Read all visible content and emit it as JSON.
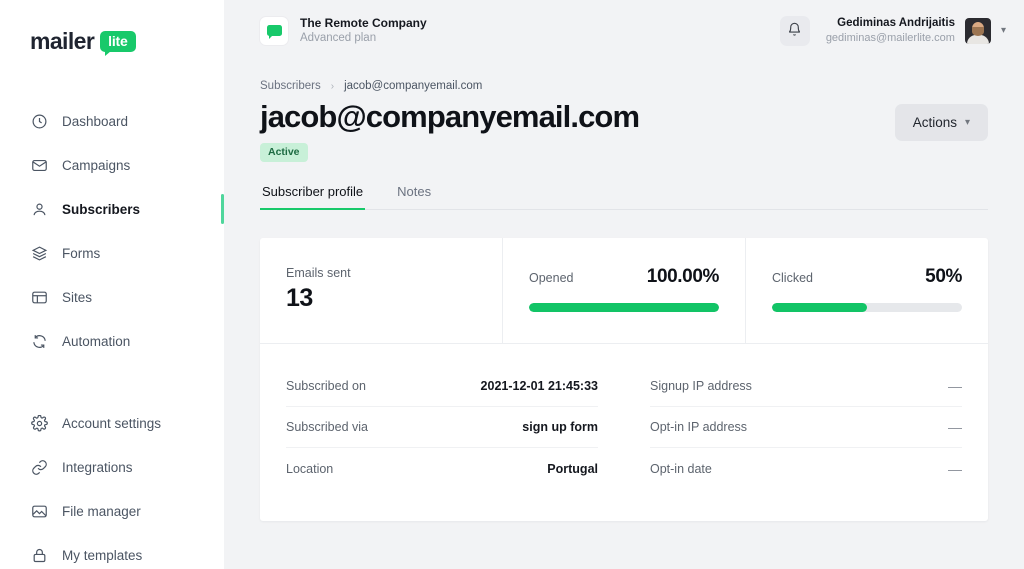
{
  "sidebar": {
    "logo": {
      "part1": "mailer",
      "part2": "lite"
    },
    "items": [
      {
        "label": "Dashboard",
        "icon": "clock-icon",
        "active": false
      },
      {
        "label": "Campaigns",
        "icon": "envelope-icon",
        "active": false
      },
      {
        "label": "Subscribers",
        "icon": "user-icon",
        "active": true
      },
      {
        "label": "Forms",
        "icon": "layers-icon",
        "active": false
      },
      {
        "label": "Sites",
        "icon": "browser-icon",
        "active": false
      },
      {
        "label": "Automation",
        "icon": "refresh-icon",
        "active": false
      },
      {
        "label": "Account settings",
        "icon": "gear-icon",
        "active": false
      },
      {
        "label": "Integrations",
        "icon": "link-icon",
        "active": false
      },
      {
        "label": "File manager",
        "icon": "image-icon",
        "active": false
      },
      {
        "label": "My templates",
        "icon": "lock-icon",
        "active": false
      }
    ]
  },
  "topbar": {
    "org_name": "The Remote Company",
    "org_plan": "Advanced plan",
    "org_logo_icon": "chat-bubble-icon",
    "bell_icon": "bell-icon",
    "user_name": "Gediminas Andrijaitis",
    "user_email": "gediminas@mailerlite.com",
    "avatar_icon": "avatar",
    "caret_icon": "chevron-down-icon"
  },
  "breadcrumb": {
    "root": "Subscribers",
    "separator": "›",
    "current": "jacob@companyemail.com"
  },
  "header": {
    "title": "jacob@companyemail.com",
    "status": "Active",
    "actions_label": "Actions",
    "actions_caret": "chevron-down-icon"
  },
  "tabs": [
    {
      "label": "Subscriber profile",
      "active": true
    },
    {
      "label": "Notes",
      "active": false
    }
  ],
  "stats": {
    "emails_sent": {
      "label": "Emails sent",
      "value": "13"
    },
    "opened": {
      "label": "Opened",
      "value": "100.00%",
      "percent": 100
    },
    "clicked": {
      "label": "Clicked",
      "value": "50%",
      "percent": 50
    }
  },
  "details": {
    "left": [
      {
        "key": "Subscribed on",
        "value": "2021-12-01 21:45:33",
        "empty": false
      },
      {
        "key": "Subscribed via",
        "value": "sign up form",
        "empty": false
      },
      {
        "key": "Location",
        "value": "Portugal",
        "empty": false
      }
    ],
    "right": [
      {
        "key": "Signup IP address",
        "value": "—",
        "empty": true
      },
      {
        "key": "Opt-in IP address",
        "value": "—",
        "empty": true
      },
      {
        "key": "Opt-in date",
        "value": "—",
        "empty": true
      }
    ]
  },
  "colors": {
    "accent_green": "#12c466",
    "logo_green": "#18c96a",
    "badge_bg": "#c8f0d8",
    "badge_text": "#1d6b42",
    "page_bg": "#f2f3f5"
  }
}
